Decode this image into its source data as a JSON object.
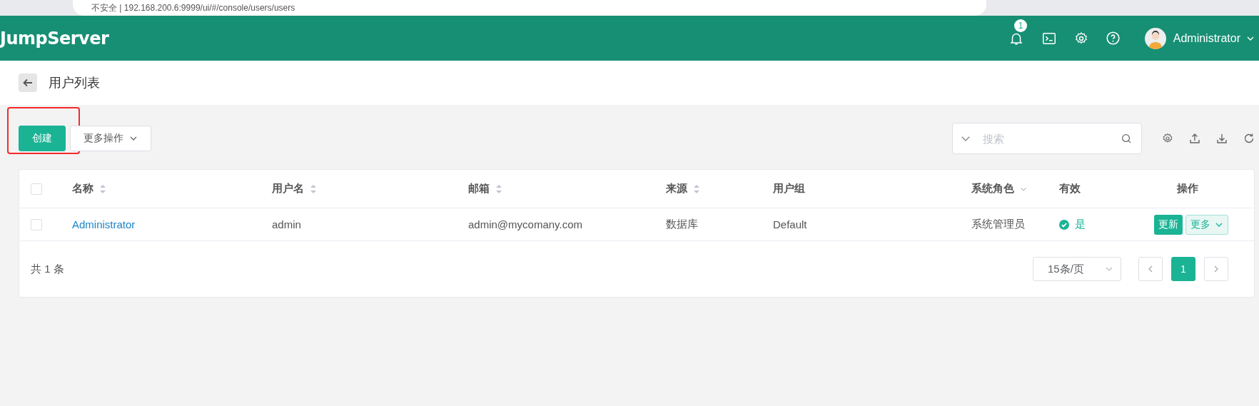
{
  "browser": {
    "address": "不安全 | 192.168.200.6:9999/ui/#/console/users/users"
  },
  "header": {
    "logo": "JumpServer",
    "notification_count": "1",
    "user": "Administrator"
  },
  "page_title": "用户列表",
  "toolbar": {
    "buttons": [
      {
        "label": "创建",
        "kind": "primary",
        "highlighted": true
      },
      {
        "label": "更多操作",
        "kind": "dropdown",
        "highlighted": false
      }
    ],
    "search": {
      "placeholder": "搜索"
    }
  },
  "table": {
    "select_all": {
      "checked": false
    },
    "columns": [
      {
        "label": "名称",
        "kind": "sort"
      },
      {
        "label": "用户名",
        "kind": "sort"
      },
      {
        "label": "邮箱",
        "kind": "sort"
      },
      {
        "label": "来源",
        "kind": "sort"
      },
      {
        "label": "用户组",
        "kind": "plain"
      },
      {
        "label": "系统角色",
        "kind": "filter"
      },
      {
        "label": "有效",
        "kind": "plain"
      },
      {
        "label": "操作",
        "kind": "center"
      }
    ],
    "rows": [
      {
        "checked": false,
        "name": "Administrator",
        "username": "admin",
        "email": "admin@mycomany.com",
        "source": "数据库",
        "group": "Default",
        "role": "系统管理员",
        "valid": {
          "on": true,
          "label": "是"
        },
        "actions": [
          {
            "label": "更新",
            "kind": "primary"
          },
          {
            "label": "更多",
            "kind": "dropdown"
          }
        ]
      }
    ]
  },
  "pagination": {
    "total": "共 1 条",
    "page_size": "15条/页",
    "pages": [
      {
        "label": "1",
        "selected": true
      }
    ]
  }
}
